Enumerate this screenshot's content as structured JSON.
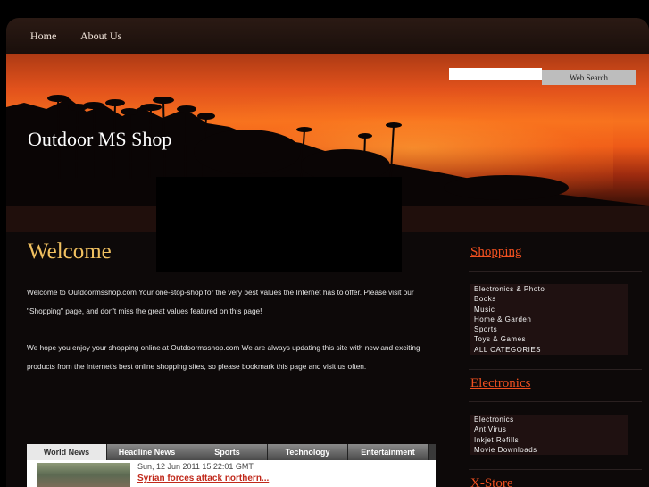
{
  "nav": {
    "home": "Home",
    "about": "About Us"
  },
  "search": {
    "placeholder": "",
    "button": "Web Search"
  },
  "site": {
    "title": "Outdoor MS Shop"
  },
  "main": {
    "heading": "Welcome",
    "paragraph1": "Welcome to Outdoormsshop.com Your one-stop-shop for the very best values the Internet has to offer. Please visit our \"Shopping\" page, and don't miss the great values featured on this page!",
    "paragraph2": "We hope you enjoy your shopping online at Outdoormsshop.com We are always updating this site with new and exciting products from the Internet's best online shopping sites, so please bookmark this page and visit us often."
  },
  "news": {
    "tabs": [
      "World News",
      "Headline News",
      "Sports",
      "Technology",
      "Entertainment"
    ],
    "active_tab": "World News",
    "date": "Sun, 12 Jun 2011 15:22:01 GMT",
    "headline": "Syrian forces attack northern..."
  },
  "sidebar": {
    "shopping": {
      "heading": "Shopping",
      "items": [
        "Electronics & Photo",
        "Books",
        "Music",
        "Home & Garden",
        "Sports",
        "Toys & Games",
        "ALL CATEGORIES"
      ]
    },
    "electronics": {
      "heading": "Electronics",
      "items": [
        "Electronics",
        "AntiVirus",
        "Inkjet Refills",
        "Movie Downloads"
      ]
    },
    "xstore": {
      "heading": "X-Store"
    }
  },
  "colors": {
    "accent_link": "#f05020",
    "welcome": "#f0c060",
    "headline": "#c0281a"
  }
}
